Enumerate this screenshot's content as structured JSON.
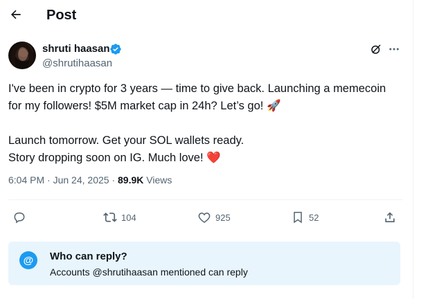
{
  "header": {
    "title": "Post",
    "back_icon": "arrow-left-icon"
  },
  "author": {
    "display_name": "shruti haasan",
    "handle": "@shrutihaasan",
    "verified": true,
    "verified_color": "#1d9bf0"
  },
  "tweet": {
    "lines": [
      "I've been in crypto for 3 years — time to give back. Launching a memecoin",
      "for my followers! $5M market cap in 24h? Let’s go!",
      "Launch tomorrow. Get your SOL wallets ready.",
      "Story dropping soon on IG. Much love!"
    ],
    "rocket_emoji": "🚀",
    "heart_emoji": "❤️"
  },
  "meta": {
    "time": "6:04 PM",
    "separator": "·",
    "date": "Jun 24, 2025",
    "views_count": "89.9K",
    "views_label": "Views"
  },
  "actions": {
    "reply_count": "",
    "retweet_count": "104",
    "like_count": "925",
    "bookmark_count": "52"
  },
  "reply_restriction": {
    "icon": "@",
    "title": "Who can reply?",
    "subtitle": "Accounts @shrutihaasan mentioned can reply",
    "background": "#e8f5fd"
  }
}
